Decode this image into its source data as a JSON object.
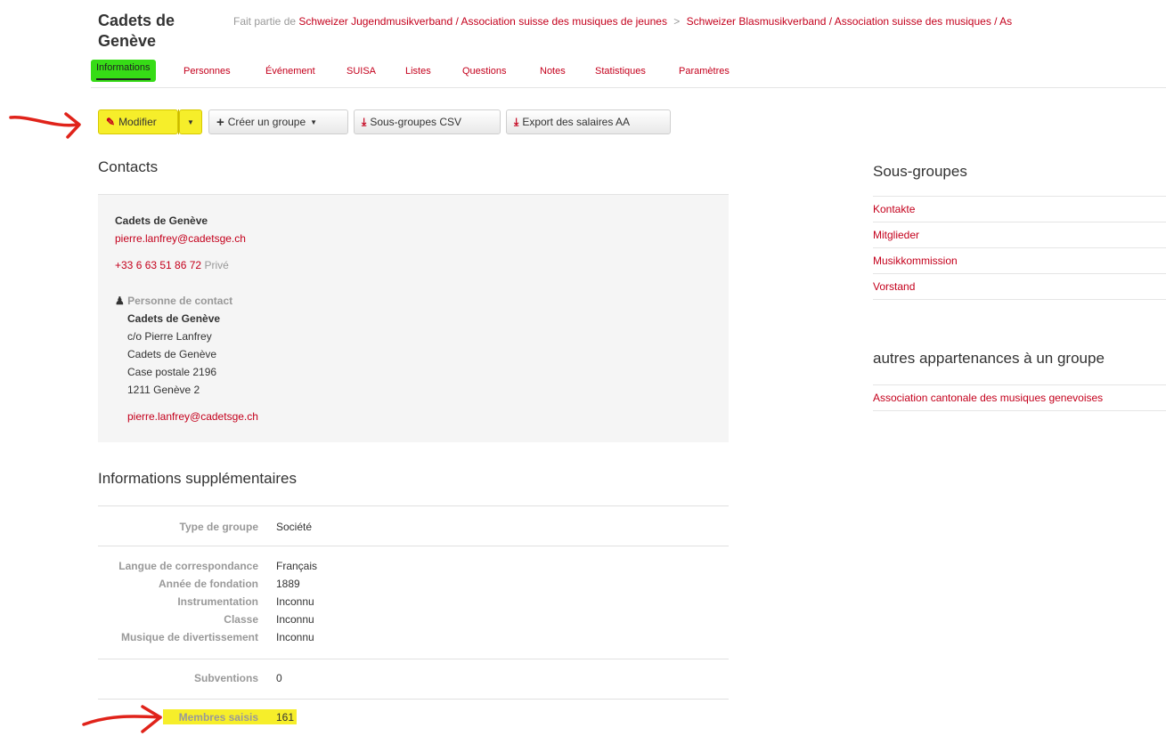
{
  "header": {
    "group_title": "Cadets de Genève",
    "breadcrumb_prefix": "Fait partie de",
    "parent_1": "Schweizer Jugendmusikverband / Association suisse des musiques de jeunes",
    "separator": ">",
    "parent_2": "Schweizer Blasmusikverband / Association suisse des musiques / As"
  },
  "tabs": [
    {
      "label": "Informations"
    },
    {
      "label": "Personnes"
    },
    {
      "label": "Événement"
    },
    {
      "label": "SUISA"
    },
    {
      "label": "Listes"
    },
    {
      "label": "Questions"
    },
    {
      "label": "Notes"
    },
    {
      "label": "Statistiques"
    },
    {
      "label": "Paramètres"
    }
  ],
  "toolbar": {
    "modify": "Modifier",
    "create_group": "Créer un groupe",
    "subgroups_csv": "Sous-groupes CSV",
    "export_salaries": "Export des salaires AA"
  },
  "contacts": {
    "heading": "Contacts",
    "name": "Cadets de Genève",
    "email": "pierre.lanfrey@cadetsge.ch",
    "phone": "+33 6 63 51 86 72",
    "phone_type": "Privé",
    "contact_person_label": "Personne de contact",
    "person_name": "Cadets de Genève",
    "address": [
      "c/o Pierre Lanfrey",
      "Cadets de Genève",
      "Case postale 2196",
      "1211 Genève 2"
    ],
    "person_email": "pierre.lanfrey@cadetsge.ch"
  },
  "subgroups": {
    "heading": "Sous-groupes",
    "items": [
      "Kontakte",
      "Mitglieder",
      "Musikkommission",
      "Vorstand"
    ]
  },
  "other_memberships": {
    "heading": "autres appartenances à un groupe",
    "items": [
      "Association cantonale des musiques genevoises"
    ]
  },
  "additional_info": {
    "heading": "Informations supplémentaires",
    "rows": [
      {
        "key": "Type de groupe",
        "value": "Société"
      },
      {
        "key": "Langue de correspondance",
        "value": "Français"
      },
      {
        "key": "Année de fondation",
        "value": "1889"
      },
      {
        "key": "Instrumentation",
        "value": "Inconnu"
      },
      {
        "key": "Classe",
        "value": "Inconnu"
      },
      {
        "key": "Musique de divertissement",
        "value": "Inconnu"
      },
      {
        "key": "Subventions",
        "value": "0"
      },
      {
        "key": "Membres saisis",
        "value": "161"
      }
    ]
  },
  "colors": {
    "link": "#c4001c",
    "highlight_yellow": "#f6ee2a",
    "highlight_green": "#36dc16",
    "annotation_red": "#e0231a"
  }
}
